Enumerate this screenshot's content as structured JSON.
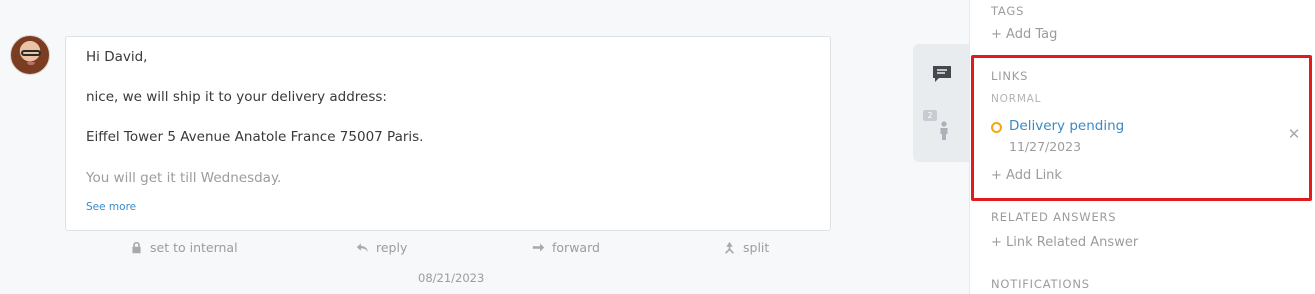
{
  "article": {
    "lines": [
      "Hi David,",
      "nice, we will ship it to your delivery address:",
      "Eiffel Tower 5 Avenue Anatole France 75007 Paris.",
      "You will get it till Wednesday."
    ],
    "see_more": "See more",
    "date": "08/21/2023",
    "actions": {
      "internal": "set to internal",
      "reply": "reply",
      "forward": "forward",
      "split": "split"
    }
  },
  "tabs": {
    "customer_badge": "2"
  },
  "sidebar": {
    "tags": {
      "title": "TAGS",
      "add": "+ Add Tag"
    },
    "links": {
      "title": "LINKS",
      "group": "NORMAL",
      "items": [
        {
          "title": "Delivery pending",
          "date": "11/27/2023",
          "status_color": "#f0a819"
        }
      ],
      "add": "+ Add Link"
    },
    "related": {
      "title": "RELATED ANSWERS",
      "add": "+ Link Related Answer"
    },
    "notifications": {
      "title": "NOTIFICATIONS"
    }
  },
  "colors": {
    "accent": "#3a8ac5",
    "highlight": "#e11b1b",
    "pending": "#f0a819"
  }
}
